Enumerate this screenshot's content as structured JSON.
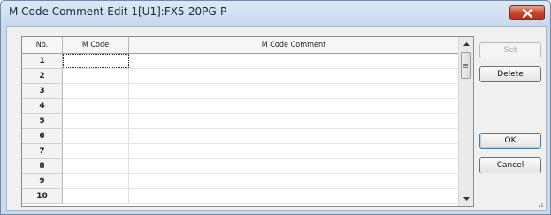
{
  "window": {
    "title": "M Code Comment Edit  1[U1]:FX5-20PG-P"
  },
  "table": {
    "headers": [
      "No.",
      "M Code",
      "M Code Comment"
    ],
    "rows": [
      {
        "no": "1",
        "m_code": "",
        "comment": ""
      },
      {
        "no": "2",
        "m_code": "",
        "comment": ""
      },
      {
        "no": "3",
        "m_code": "",
        "comment": ""
      },
      {
        "no": "4",
        "m_code": "",
        "comment": ""
      },
      {
        "no": "5",
        "m_code": "",
        "comment": ""
      },
      {
        "no": "6",
        "m_code": "",
        "comment": ""
      },
      {
        "no": "7",
        "m_code": "",
        "comment": ""
      },
      {
        "no": "8",
        "m_code": "",
        "comment": ""
      },
      {
        "no": "9",
        "m_code": "",
        "comment": ""
      },
      {
        "no": "10",
        "m_code": "",
        "comment": ""
      }
    ]
  },
  "buttons": {
    "set": "Set",
    "delete": "Delete",
    "ok": "OK",
    "cancel": "Cancel"
  },
  "icons": {
    "close": "close-icon",
    "scroll_up": "scroll-up-arrow-icon",
    "scroll_down": "scroll-down-arrow-icon",
    "resize_grip": "resize-grip-icon"
  },
  "colors": {
    "close_button": "#c7452d",
    "title_bar": "#c9daec",
    "default_button_border": "#3c7fb1"
  }
}
